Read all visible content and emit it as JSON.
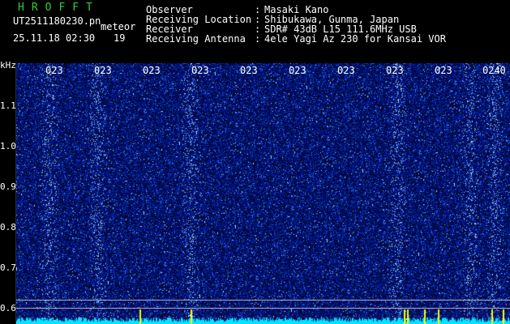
{
  "brand": "HROFFT",
  "file": {
    "name": "UT2511180230.pn",
    "tag": "meteor",
    "datetime": "25.11.18 02:30",
    "count": "19"
  },
  "info": [
    {
      "label": "Observer",
      "value": "Masaki Kano"
    },
    {
      "label": "Receiving Location",
      "value": "Shibukawa, Gunma, Japan"
    },
    {
      "label": "Receiver",
      "value": "SDR# 43dB L15 111.6MHz USB"
    },
    {
      "label": "Receiving Antenna",
      "value": "4ele Yagi Az 230 for Kansai VOR"
    }
  ],
  "yaxis": {
    "unit": "kHz",
    "labels": [
      "1.1",
      "1.0",
      "0.9",
      "0.8",
      "0.7",
      "0.6"
    ]
  },
  "time_labels": [
    "023",
    "023",
    "023",
    "023",
    "023",
    "023",
    "023",
    "023",
    "023",
    "0240"
  ],
  "colors": {
    "background": "#000000",
    "plot": "#000a3a",
    "brand": "#33cc33",
    "signal": "#00e5ff",
    "marker": "#ffff00"
  }
}
